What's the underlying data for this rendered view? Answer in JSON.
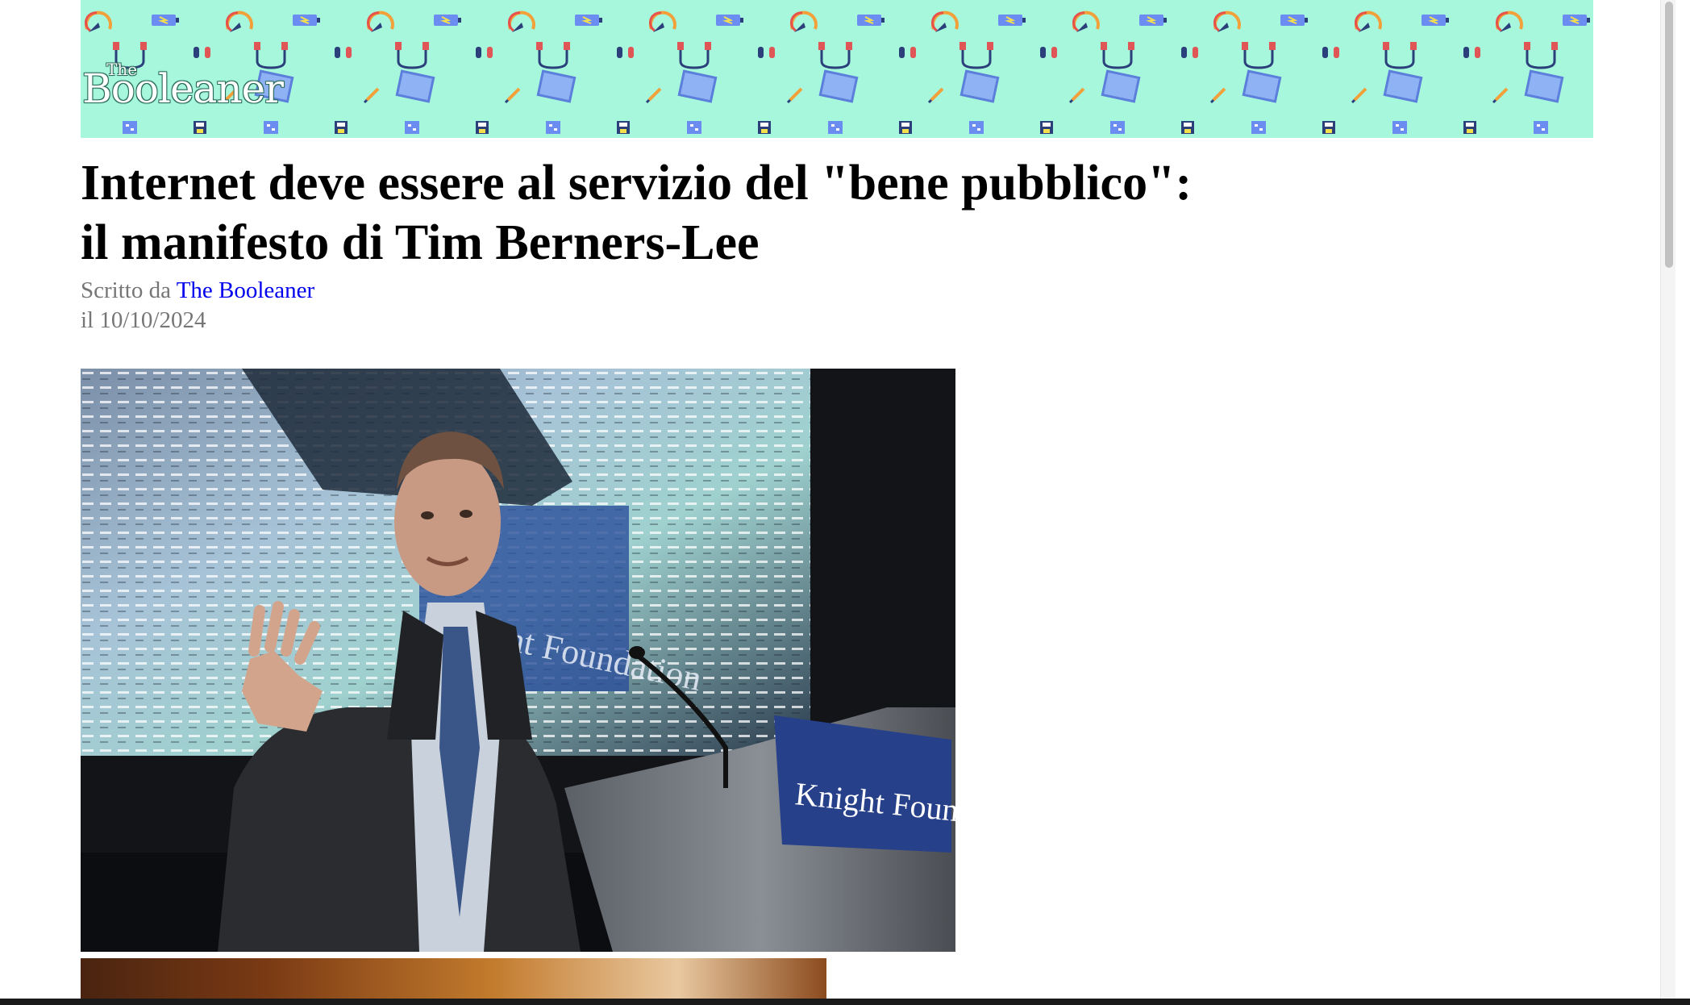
{
  "site": {
    "logo_small": "The",
    "logo_main": "Booleaner",
    "banner_color": "#a6f7dc"
  },
  "article": {
    "title_line1": "Internet deve essere al servizio del \"bene pubblico\":",
    "title_line2": "il manifesto di Tim Berners-Lee",
    "byline_prefix": "Scritto da",
    "author": "The Booleaner",
    "date": "il 10/10/2024",
    "photo_sign_text": "Knight Foundation",
    "photo_screen_text": "Knight Foundation"
  },
  "colors": {
    "link": "#0000ee",
    "meta_text": "#767676",
    "title_text": "#000000"
  },
  "icons": [
    "speedometer-icon",
    "battery-icon",
    "usb-cable-icon",
    "earbuds-icon",
    "monitor-icon",
    "pen-icon",
    "cpu-icon",
    "floppy-disk-icon"
  ]
}
